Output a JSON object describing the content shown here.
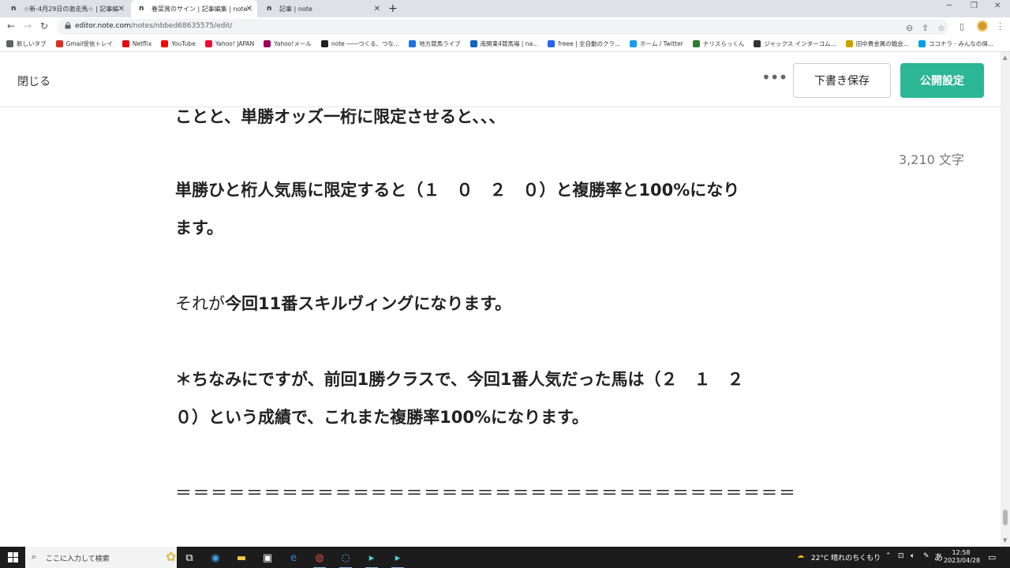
{
  "browser": {
    "tabs": [
      {
        "label": "☆新-4月29日の激走馬☆ | 記事編",
        "active": false
      },
      {
        "label": "春菜賞のサイン | 記事編集 | note",
        "active": true
      },
      {
        "label": "記事 | note",
        "active": false
      }
    ],
    "url_host": "editor.note.com",
    "url_path": "/notes/nbbed68635575/edit/"
  },
  "bookmarks": [
    {
      "label": "新しいタブ",
      "icon": "globe-icon",
      "color": "#5f6368"
    },
    {
      "label": "Gmail受信トレイ",
      "icon": "gmail-icon",
      "color": "#d93025"
    },
    {
      "label": "Netflix",
      "icon": "netflix-icon",
      "color": "#e50914"
    },
    {
      "label": "YouTube",
      "icon": "youtube-icon",
      "color": "#ff0000"
    },
    {
      "label": "Yahoo! JAPAN",
      "icon": "yahoo-icon",
      "color": "#ff0033"
    },
    {
      "label": "Yahoo!メール",
      "icon": "yahoo-mail-icon",
      "color": "#a0005a"
    },
    {
      "label": "note ――つくる、つな...",
      "icon": "note-icon",
      "color": "#222222"
    },
    {
      "label": "地方競馬ライブ",
      "icon": "keiba-live-icon",
      "color": "#1a73e8"
    },
    {
      "label": "南関東4競馬場 | na...",
      "icon": "nankan-icon",
      "color": "#1565c0"
    },
    {
      "label": "freee | 全自動のクラ...",
      "icon": "freee-icon",
      "color": "#2864f0"
    },
    {
      "label": "ホーム / Twitter",
      "icon": "twitter-icon",
      "color": "#1d9bf0"
    },
    {
      "label": "ナリスらっくん",
      "icon": "narisu-icon",
      "color": "#2e7d32"
    },
    {
      "label": "ジャックス インターコム...",
      "icon": "jaccs-icon",
      "color": "#333333"
    },
    {
      "label": "田中貴金属の戦会...",
      "icon": "tanaka-icon",
      "color": "#c9a100"
    },
    {
      "label": "ココナラ - みんなの得...",
      "icon": "coconala-icon",
      "color": "#00a0e9"
    }
  ],
  "editor": {
    "close_label": "閉じる",
    "more_label": "•••",
    "draft_label": "下書き保存",
    "publish_label": "公開設定",
    "char_count": "3,210 文字"
  },
  "article": {
    "line_cut": "ことと、単勝オッズ一桁に限定させると、、、",
    "line_2a": "単勝ひと桁人気馬に限定すると（１　０　２　０）と複勝率と100%になり",
    "line_2b": "ます。",
    "line_3_normal": "それが",
    "line_3_bold": "今回11番スキルヴィングになります。",
    "line_4a": "＊ちなみにですが、前回1勝クラスで、今回1番人気だった馬は（２　１　２",
    "line_4b": "０）という成績で、これまた複勝率100%になります。",
    "divider": "＝＝＝＝＝＝＝＝＝＝＝＝＝＝＝＝＝＝＝＝＝＝＝＝＝＝＝＝＝＝＝＝＝＝＝"
  },
  "taskbar": {
    "search_placeholder": "ここに入力して検索",
    "weather": "22°C  晴れのちくもり",
    "ime": "あ",
    "time": "12:58",
    "date": "2023/04/28"
  }
}
